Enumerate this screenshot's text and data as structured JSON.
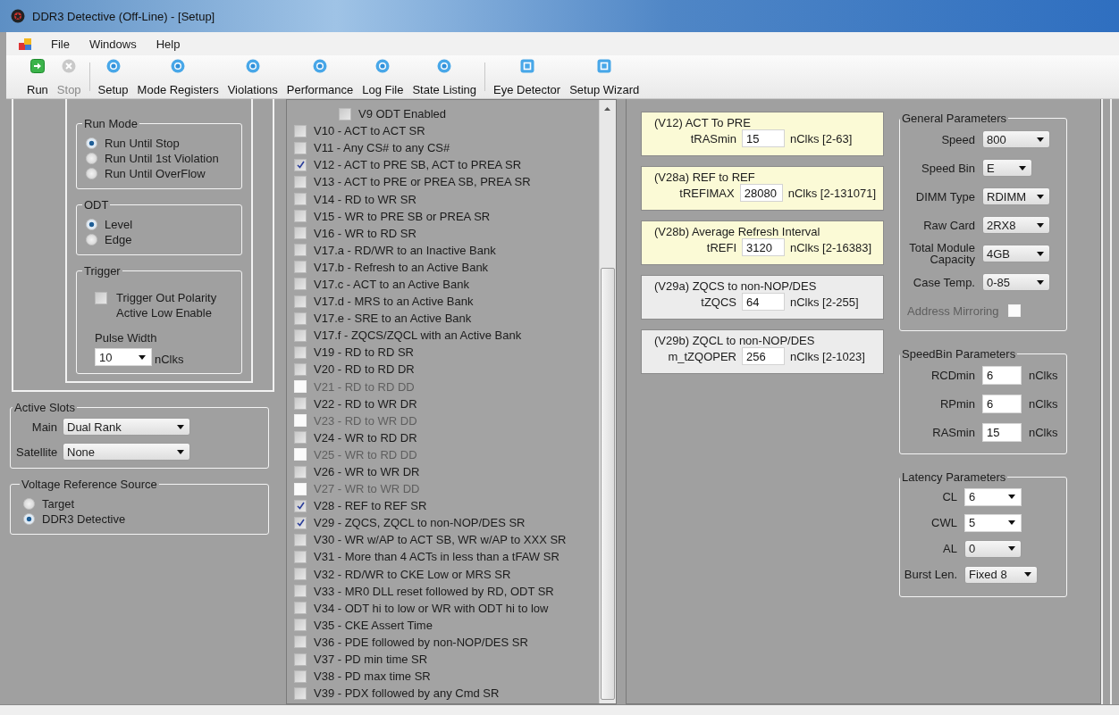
{
  "window": {
    "title": "DDR3 Detective (Off-Line) - [Setup]"
  },
  "menu": [
    "File",
    "Windows",
    "Help"
  ],
  "toolbar": {
    "groups": [
      [
        {
          "label": "Run",
          "kind": "run",
          "disabled": false
        },
        {
          "label": "Stop",
          "kind": "stop",
          "disabled": true
        }
      ],
      [
        {
          "label": "Setup",
          "kind": "circle",
          "disabled": false
        },
        {
          "label": "Mode Registers",
          "kind": "circle",
          "disabled": false
        },
        {
          "label": "Violations",
          "kind": "circle",
          "disabled": false
        },
        {
          "label": "Performance",
          "kind": "circle",
          "disabled": false
        },
        {
          "label": "Log File",
          "kind": "circle",
          "disabled": false
        },
        {
          "label": "State Listing",
          "kind": "circle",
          "disabled": false
        }
      ],
      [
        {
          "label": "Eye Detector",
          "kind": "square",
          "disabled": false
        },
        {
          "label": "Setup Wizard",
          "kind": "square",
          "disabled": false
        }
      ]
    ]
  },
  "run_mode": {
    "title": "Run Mode",
    "options": [
      {
        "label": "Run Until Stop",
        "selected": true
      },
      {
        "label": "Run Until 1st Violation",
        "selected": false
      },
      {
        "label": "Run Until OverFlow",
        "selected": false
      }
    ]
  },
  "odt": {
    "title": "ODT",
    "options": [
      {
        "label": "Level",
        "selected": true
      },
      {
        "label": "Edge",
        "selected": false
      }
    ]
  },
  "trigger": {
    "title": "Trigger",
    "checkbox": {
      "label": "Trigger Out Polarity Active Low Enable",
      "checked": false
    },
    "pulse_width": {
      "label": "Pulse Width",
      "kind": "edit",
      "value": "10",
      "unit": "nClks"
    }
  },
  "active_slots": {
    "title": "Active Slots",
    "fields": [
      {
        "label": "Main",
        "kind": "list",
        "value": "Dual Rank"
      },
      {
        "label": "Satellite",
        "kind": "list",
        "value": "None"
      }
    ]
  },
  "voltage_reference": {
    "title": "Voltage Reference Source",
    "options": [
      {
        "label": "Target",
        "selected": false
      },
      {
        "label": "DDR3 Detective",
        "selected": true
      }
    ]
  },
  "violations": [
    {
      "kind": "sub",
      "label": "V9 ODT Enabled",
      "checked": false,
      "disabled": false
    },
    {
      "kind": "item",
      "label": "V10 - ACT to ACT SR",
      "checked": false,
      "disabled": false
    },
    {
      "kind": "item",
      "label": "V11 - Any CS# to any CS#",
      "checked": false,
      "disabled": false
    },
    {
      "kind": "item",
      "label": "V12 - ACT to PRE SB, ACT to PREA SR",
      "checked": true,
      "disabled": false
    },
    {
      "kind": "item",
      "label": "V13 - ACT to PRE or PREA SB, PREA SR",
      "checked": false,
      "disabled": false
    },
    {
      "kind": "item",
      "label": "V14 - RD to WR SR",
      "checked": false,
      "disabled": false
    },
    {
      "kind": "item",
      "label": "V15 - WR to PRE SB or PREA SR",
      "checked": false,
      "disabled": false
    },
    {
      "kind": "item",
      "label": "V16 - WR to RD SR",
      "checked": false,
      "disabled": false
    },
    {
      "kind": "item",
      "label": "V17.a - RD/WR to an Inactive Bank",
      "checked": false,
      "disabled": false
    },
    {
      "kind": "item",
      "label": "V17.b - Refresh to an Active Bank",
      "checked": false,
      "disabled": false
    },
    {
      "kind": "item",
      "label": "V17.c - ACT to an Active Bank",
      "checked": false,
      "disabled": false
    },
    {
      "kind": "item",
      "label": "V17.d - MRS to an Active Bank",
      "checked": false,
      "disabled": false
    },
    {
      "kind": "item",
      "label": "V17.e - SRE to an Active Bank",
      "checked": false,
      "disabled": false
    },
    {
      "kind": "item",
      "label": "V17.f - ZQCS/ZQCL with an Active Bank",
      "checked": false,
      "disabled": false
    },
    {
      "kind": "item",
      "label": "V19 - RD to RD SR",
      "checked": false,
      "disabled": false
    },
    {
      "kind": "item",
      "label": "V20 - RD to RD DR",
      "checked": false,
      "disabled": false
    },
    {
      "kind": "item",
      "label": "V21 - RD to RD DD",
      "checked": false,
      "disabled": true
    },
    {
      "kind": "item",
      "label": "V22 - RD to WR DR",
      "checked": false,
      "disabled": false
    },
    {
      "kind": "item",
      "label": "V23 - RD to WR DD",
      "checked": false,
      "disabled": true
    },
    {
      "kind": "item",
      "label": "V24 - WR to RD DR",
      "checked": false,
      "disabled": false
    },
    {
      "kind": "item",
      "label": "V25 - WR to RD DD",
      "checked": false,
      "disabled": true
    },
    {
      "kind": "item",
      "label": "V26 - WR to WR DR",
      "checked": false,
      "disabled": false
    },
    {
      "kind": "item",
      "label": "V27 - WR to WR DD",
      "checked": false,
      "disabled": true
    },
    {
      "kind": "item",
      "label": "V28 - REF to REF SR",
      "checked": true,
      "disabled": false
    },
    {
      "kind": "item",
      "label": "V29 - ZQCS, ZQCL to non-NOP/DES SR",
      "checked": true,
      "disabled": false
    },
    {
      "kind": "item",
      "label": "V30 - WR w/AP to ACT SB, WR w/AP to XXX SR",
      "checked": false,
      "disabled": false
    },
    {
      "kind": "item",
      "label": "V31 - More than 4 ACTs in less than a tFAW SR",
      "checked": false,
      "disabled": false
    },
    {
      "kind": "item",
      "label": "V32 - RD/WR to CKE Low or MRS SR",
      "checked": false,
      "disabled": false
    },
    {
      "kind": "item",
      "label": "V33 - MR0 DLL reset followed by RD, ODT SR",
      "checked": false,
      "disabled": false
    },
    {
      "kind": "item",
      "label": "V34 - ODT hi to low or WR with ODT hi to low",
      "checked": false,
      "disabled": false
    },
    {
      "kind": "item",
      "label": "V35 - CKE Assert Time",
      "checked": false,
      "disabled": false
    },
    {
      "kind": "item",
      "label": "V36 - PDE followed by non-NOP/DES SR",
      "checked": false,
      "disabled": false
    },
    {
      "kind": "item",
      "label": "V37 - PD min time SR",
      "checked": false,
      "disabled": false
    },
    {
      "kind": "item",
      "label": "V38 - PD max time SR",
      "checked": false,
      "disabled": false
    },
    {
      "kind": "item",
      "label": "V39 - PDX followed by any Cmd SR",
      "checked": false,
      "disabled": false
    }
  ],
  "parameter_cards": [
    {
      "title": "(V12) ACT To PRE",
      "label": "tRASmin",
      "value": "15",
      "range": "nClks [2-63]",
      "highlighted": true
    },
    {
      "title": "(V28a) REF to REF",
      "label": "tREFIMAX",
      "value": "28080",
      "range": "nClks [2-131071]",
      "highlighted": true
    },
    {
      "title": "(V28b) Average Refresh Interval",
      "label": "tREFI",
      "value": "3120",
      "range": "nClks [2-16383]",
      "highlighted": true
    },
    {
      "title": "(V29a) ZQCS to non-NOP/DES",
      "label": "tZQCS",
      "value": "64",
      "range": "nClks [2-255]",
      "highlighted": false
    },
    {
      "title": "(V29b) ZQCL to non-NOP/DES",
      "label": "m_tZQOPER",
      "value": "256",
      "range": "nClks [2-1023]",
      "highlighted": false
    }
  ],
  "general_parameters": {
    "title": "General Parameters",
    "fields": [
      {
        "kind": "list",
        "label": "Speed",
        "value": "800"
      },
      {
        "kind": "list",
        "label": "Speed Bin",
        "value": "E"
      },
      {
        "kind": "list",
        "label": "DIMM Type",
        "value": "RDIMM"
      },
      {
        "kind": "list",
        "label": "Raw Card",
        "value": "2RX8"
      },
      {
        "kind": "list",
        "label": "Total Module Capacity",
        "value": "4GB"
      },
      {
        "kind": "list",
        "label": "Case Temp.",
        "value": "0-85"
      },
      {
        "kind": "checkbox",
        "label": "Address Mirroring",
        "checked": false,
        "disabled": true
      }
    ]
  },
  "speedbin_parameters": {
    "title": "SpeedBin Parameters",
    "fields": [
      {
        "label": "RCDmin",
        "value": "6",
        "unit": "nClks"
      },
      {
        "label": "RPmin",
        "value": "6",
        "unit": "nClks"
      },
      {
        "label": "RASmin",
        "value": "15",
        "unit": "nClks"
      }
    ]
  },
  "latency_parameters": {
    "title": "Latency Parameters",
    "fields": [
      {
        "kind": "edit",
        "label": "CL",
        "value": "6"
      },
      {
        "kind": "edit",
        "label": "CWL",
        "value": "5"
      },
      {
        "kind": "list",
        "label": "AL",
        "value": "0"
      },
      {
        "kind": "list",
        "label": "Burst Len.",
        "value": "Fixed 8"
      }
    ]
  }
}
